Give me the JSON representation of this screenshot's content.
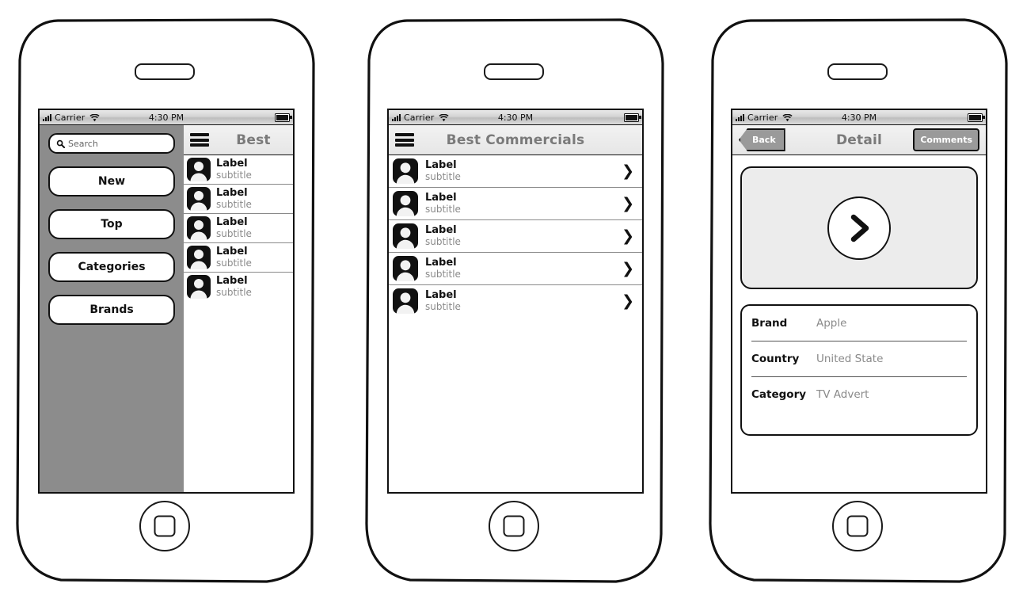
{
  "status_bar": {
    "carrier": "Carrier",
    "time": "4:30 PM",
    "signal_icon": "signal-bars-icon",
    "wifi_icon": "wifi-icon",
    "battery_icon": "battery-icon"
  },
  "phones": [
    {
      "id": "phone-menu",
      "nav": {
        "menu_icon": "hamburger-menu-icon",
        "title": "Best"
      },
      "sidebar": {
        "search": {
          "placeholder": "Search",
          "value": "Search",
          "icon": "search-icon"
        },
        "buttons": [
          {
            "label": "New"
          },
          {
            "label": "Top"
          },
          {
            "label": "Categories"
          },
          {
            "label": "Brands"
          }
        ]
      },
      "list": [
        {
          "label": "Label",
          "subtitle": "subtitle",
          "avatar": "user-avatar-icon"
        },
        {
          "label": "Label",
          "subtitle": "subtitle",
          "avatar": "user-avatar-icon"
        },
        {
          "label": "Label",
          "subtitle": "subtitle",
          "avatar": "user-avatar-icon"
        },
        {
          "label": "Label",
          "subtitle": "subtitle",
          "avatar": "user-avatar-icon"
        },
        {
          "label": "Label",
          "subtitle": "subtitle",
          "avatar": "user-avatar-icon"
        }
      ]
    },
    {
      "id": "phone-list",
      "nav": {
        "menu_icon": "hamburger-menu-icon",
        "title": "Best Commercials"
      },
      "list": [
        {
          "label": "Label",
          "subtitle": "subtitle",
          "avatar": "user-avatar-icon",
          "chevron": "chevron-right-icon"
        },
        {
          "label": "Label",
          "subtitle": "subtitle",
          "avatar": "user-avatar-icon",
          "chevron": "chevron-right-icon"
        },
        {
          "label": "Label",
          "subtitle": "subtitle",
          "avatar": "user-avatar-icon",
          "chevron": "chevron-right-icon"
        },
        {
          "label": "Label",
          "subtitle": "subtitle",
          "avatar": "user-avatar-icon",
          "chevron": "chevron-right-icon"
        },
        {
          "label": "Label",
          "subtitle": "subtitle",
          "avatar": "user-avatar-icon",
          "chevron": "chevron-right-icon"
        }
      ]
    },
    {
      "id": "phone-detail",
      "nav": {
        "back_label": "Back",
        "title": "Detail",
        "comments_label": "Comments"
      },
      "player": {
        "play_icon": "play-chevron-icon"
      },
      "info": [
        {
          "key": "Brand",
          "value": "Apple"
        },
        {
          "key": "Country",
          "value": "United State"
        },
        {
          "key": "Category",
          "value": "TV Advert"
        }
      ]
    }
  ],
  "colors": {
    "sidebar_gray": "#8c8c8c",
    "nav_gray": "#ececec",
    "title_gray": "#7a7a7a",
    "button_gray": "#9a9a9a",
    "ink": "#111111",
    "subtitle_gray": "#8a8a8a"
  }
}
